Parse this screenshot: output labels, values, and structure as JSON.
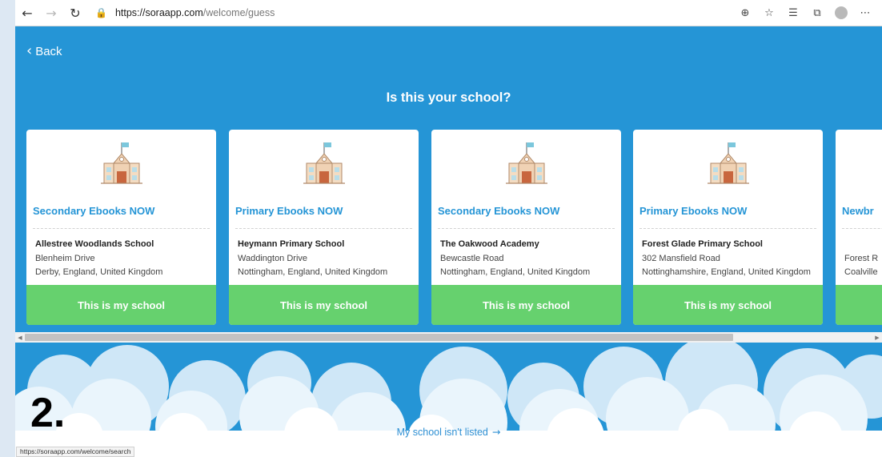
{
  "browser": {
    "back_icon": "arrow-left-icon",
    "forward_icon": "arrow-right-icon",
    "refresh_icon": "refresh-icon",
    "url_host": "https://soraapp.com",
    "url_path": "/welcome/guess",
    "toolbar_icons": [
      "add-tab-icon",
      "favorite-star-icon",
      "favorites-list-icon",
      "collections-icon",
      "profile-avatar-icon",
      "more-icon"
    ],
    "status_url": "https://soraapp.com/welcome/search"
  },
  "app": {
    "back_label": "Back",
    "title": "Is this your school?",
    "accent_color": "#2595d6",
    "button_color": "#66d16e",
    "button_label": "This is my school",
    "schools": [
      {
        "collection": "Secondary Ebooks NOW",
        "name": "Allestree Woodlands School",
        "address_line": "Blenheim Drive",
        "locality": "Derby, England, United Kingdom",
        "button": "This is my school"
      },
      {
        "collection": "Primary Ebooks NOW",
        "name": "Heymann Primary School",
        "address_line": "Waddington Drive",
        "locality": "Nottingham, England, United Kingdom",
        "button": "This is my school"
      },
      {
        "collection": "Secondary Ebooks NOW",
        "name": "The Oakwood Academy",
        "address_line": "Bewcastle Road",
        "locality": "Nottingham, England, United Kingdom",
        "button": "This is my school"
      },
      {
        "collection": "Primary Ebooks NOW",
        "name": "Forest Glade Primary School",
        "address_line": "302 Mansfield Road",
        "locality": "Nottinghamshire, England, United Kingdom",
        "button": "This is my school"
      },
      {
        "collection": "Newbr",
        "name": "",
        "address_line": "Forest R",
        "locality": "Coalville",
        "button": ""
      }
    ],
    "not_listed_label": "My school isn't listed"
  },
  "annotation": {
    "step": "2."
  }
}
